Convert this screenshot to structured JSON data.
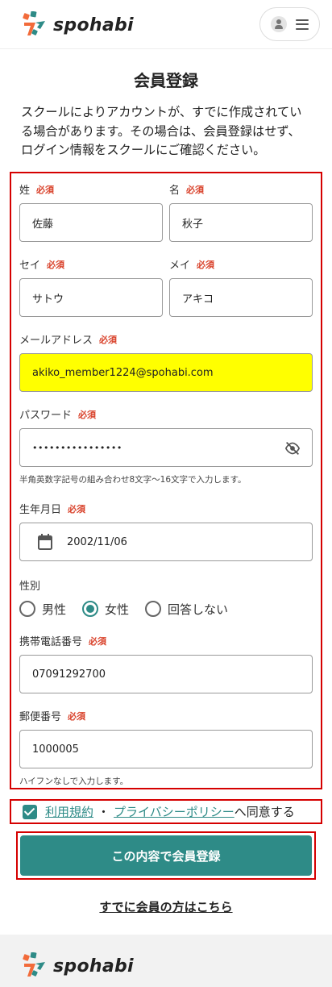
{
  "header": {
    "logo_text": "spohabi",
    "logo_icon": "spohabi-logo-icon",
    "account_icon": "user-icon",
    "menu_icon": "hamburger-menu-icon"
  },
  "page": {
    "title": "会員登録",
    "intro": "スクールによりアカウントが、すでに作成されている場合があります。その場合は、会員登録はせず、 ログイン情報をスクールにご確認ください。"
  },
  "form": {
    "required_label": "必須",
    "last_name": {
      "label": "姓",
      "value": "佐藤"
    },
    "first_name": {
      "label": "名",
      "value": "秋子"
    },
    "last_name_kana": {
      "label": "セイ",
      "value": "サトウ"
    },
    "first_name_kana": {
      "label": "メイ",
      "value": "アキコ"
    },
    "email": {
      "label": "メールアドレス",
      "value": "akiko_member1224@spohabi.com"
    },
    "password": {
      "label": "パスワード",
      "value": "••••••••••••••••",
      "hint": "半角英数字記号の組み合わせ8文字〜16文字で入力します。"
    },
    "birthday": {
      "label": "生年月日",
      "value": "2002/11/06"
    },
    "gender": {
      "label": "性別",
      "options": [
        "男性",
        "女性",
        "回答しない"
      ],
      "selected": "女性"
    },
    "phone": {
      "label": "携帯電話番号",
      "value": "07091292700"
    },
    "postal": {
      "label": "郵便番号",
      "value": "1000005",
      "hint": "ハイフンなしで入力します。"
    }
  },
  "agreement": {
    "checked": true,
    "terms_link": "利用規約",
    "separator": "・",
    "privacy_link": "プライバシーポリシー",
    "suffix": "へ同意する"
  },
  "submit_label": "この内容で会員登録",
  "login_link": "すでに会員の方はこちら",
  "footer": {
    "logo_text": "spohabi"
  },
  "colors": {
    "accent": "#2e8b87",
    "required": "#d9412a",
    "highlight_border": "#d50000",
    "email_bg": "#ffff00"
  }
}
